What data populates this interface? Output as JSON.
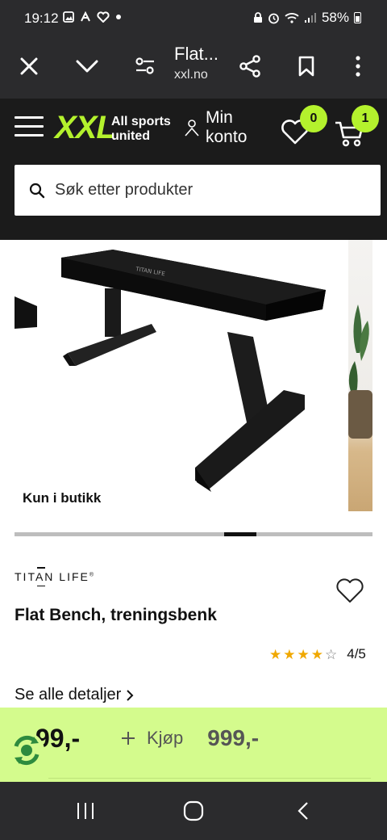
{
  "status_bar": {
    "time": "19:12",
    "battery": "58%"
  },
  "browser": {
    "page_title": "Flat...",
    "url": "xxl.no"
  },
  "header": {
    "logo": "XXL",
    "tagline_line1": "All sports",
    "tagline_line2": "united",
    "account_line1": "Min",
    "account_line2": "konto",
    "wishlist_count": "0",
    "cart_count": "1",
    "search_placeholder": "Søk etter produkter"
  },
  "gallery": {
    "badge": "Kun i butikk",
    "progress": 0.6
  },
  "product": {
    "brand": "TITAN LIFE",
    "title": "Flat Bench, treningsbenk",
    "rating": 4,
    "rating_max": 5,
    "rating_text": "4/5",
    "details_link": "Se alle detaljer"
  },
  "buy_bar": {
    "partial_price": "99,-",
    "buy_label": "Kjøp",
    "price": "999,-"
  },
  "colors": {
    "accent": "#b4f22d",
    "buy_bar": "#d4fb8d",
    "header_bg": "#1b1b1b",
    "star": "#f0a800"
  }
}
